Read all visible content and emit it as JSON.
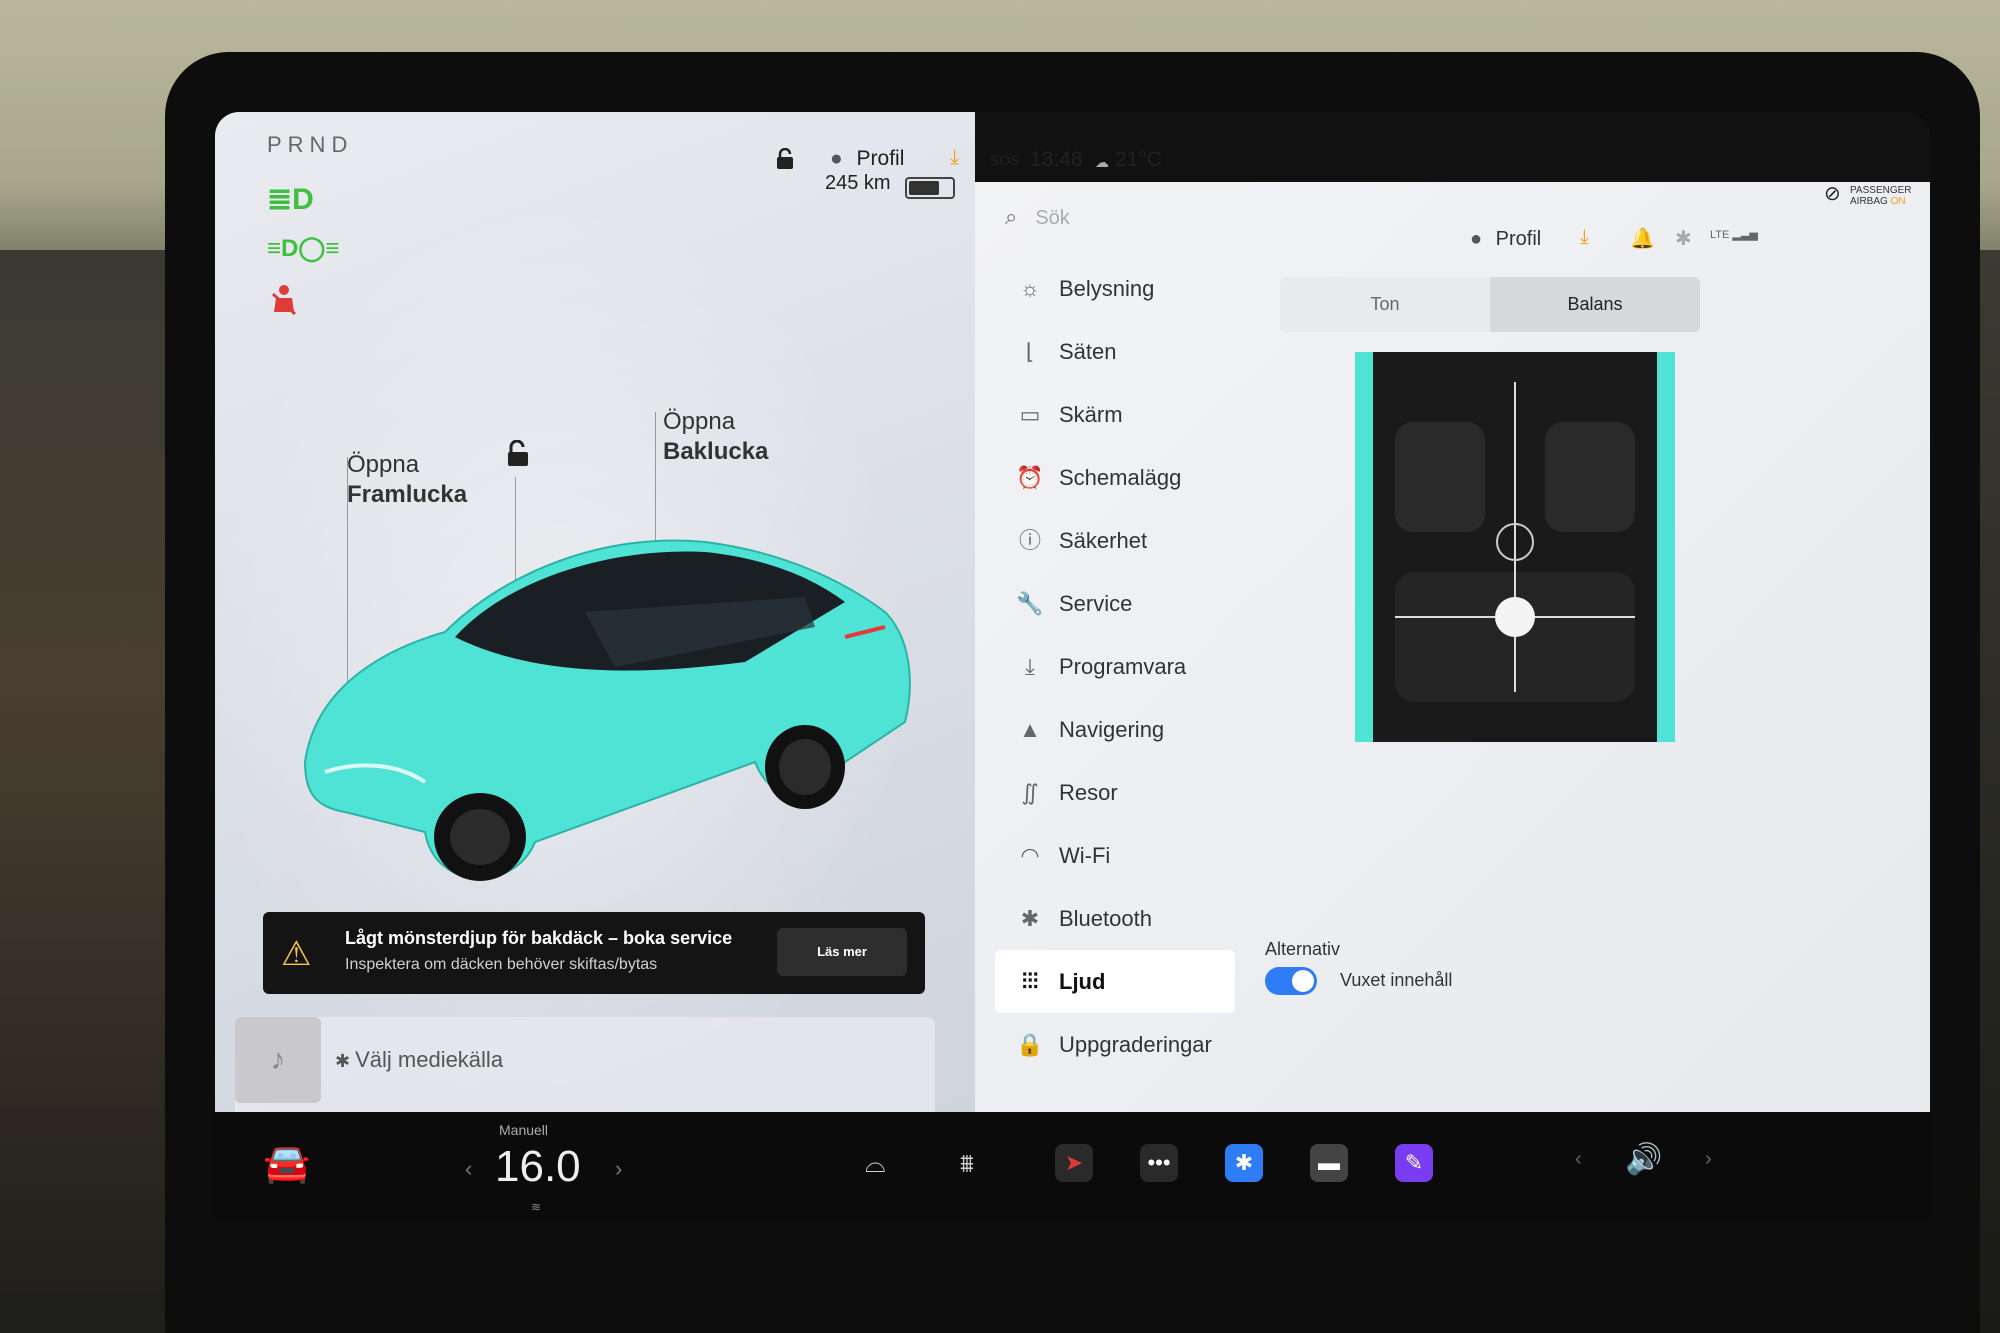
{
  "gear": "PRND",
  "range": "245 km",
  "status": {
    "profile": "Profil",
    "sos": "SOS",
    "time": "13:48",
    "temp": "21°C"
  },
  "car": {
    "open_front": [
      "Öppna",
      "Framlucka"
    ],
    "open_trunk": [
      "Öppna",
      "Baklucka"
    ],
    "color": "#4fe3d6"
  },
  "alert": {
    "title": "Lågt mönsterdjup för bakdäck – boka service",
    "subtitle": "Inspektera om däcken behöver skiftas/bytas",
    "button": "Läs mer"
  },
  "media": {
    "source": "Välj mediekälla"
  },
  "search": {
    "placeholder": "Sök"
  },
  "menu": [
    {
      "label": "Belysning",
      "icon": "sun-icon"
    },
    {
      "label": "Säten",
      "icon": "seat-icon"
    },
    {
      "label": "Skärm",
      "icon": "screen-icon"
    },
    {
      "label": "Schemalägg",
      "icon": "alarm-icon"
    },
    {
      "label": "Säkerhet",
      "icon": "safety-icon"
    },
    {
      "label": "Service",
      "icon": "wrench-icon"
    },
    {
      "label": "Programvara",
      "icon": "download-icon"
    },
    {
      "label": "Navigering",
      "icon": "navigation-icon"
    },
    {
      "label": "Resor",
      "icon": "trips-icon"
    },
    {
      "label": "Wi-Fi",
      "icon": "wifi-icon"
    },
    {
      "label": "Bluetooth",
      "icon": "bluetooth-icon"
    },
    {
      "label": "Ljud",
      "icon": "equalizer-icon"
    },
    {
      "label": "Uppgraderingar",
      "icon": "lock-icon"
    }
  ],
  "sound": {
    "profile": "Profil",
    "lte": "LTE",
    "airbag": [
      "PASSENGER",
      "AIRBAG"
    ],
    "airbag_state": "ON",
    "tabs": [
      "Ton",
      "Balans"
    ],
    "selected_tab": "Balans",
    "alternatives_title": "Alternativ",
    "adult_content": "Vuxet innehåll",
    "adult_content_on": true
  },
  "bottom": {
    "climate_mode": "Manuell",
    "temperature": "16.0"
  },
  "colors": {
    "accent": "#2e7cf6",
    "indicator_green": "#3fbf3f",
    "warning": "#f5c542",
    "orange": "#f0a020"
  }
}
